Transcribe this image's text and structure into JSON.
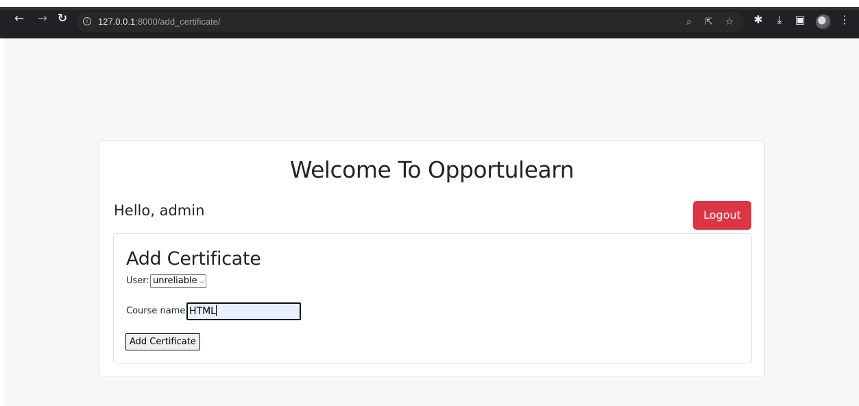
{
  "browser": {
    "url_host": "127.0.0.1",
    "url_path": ":8000/add_certificate/",
    "icons": [
      "back-icon",
      "forward-icon",
      "reload-icon",
      "info-icon",
      "zoom-icon",
      "share-icon",
      "star-icon",
      "extensions-icon",
      "download-icon",
      "sidepanel-icon",
      "avatar",
      "menu-icon"
    ]
  },
  "page": {
    "welcome_title": "Welcome To Opportulearn",
    "greeting": "Hello, admin",
    "logout_label": "Logout"
  },
  "form": {
    "title": "Add Certificate",
    "user_label": "User:",
    "user_selected": "unreliable",
    "course_label": "Course name:",
    "course_value": "HTML",
    "submit_label": "Add Certificate"
  },
  "colors": {
    "browser_bg": "#202124",
    "page_bg": "#f7f7f7",
    "logout_bg": "#dc3545",
    "input_autofill_bg": "#e8f0fe"
  }
}
